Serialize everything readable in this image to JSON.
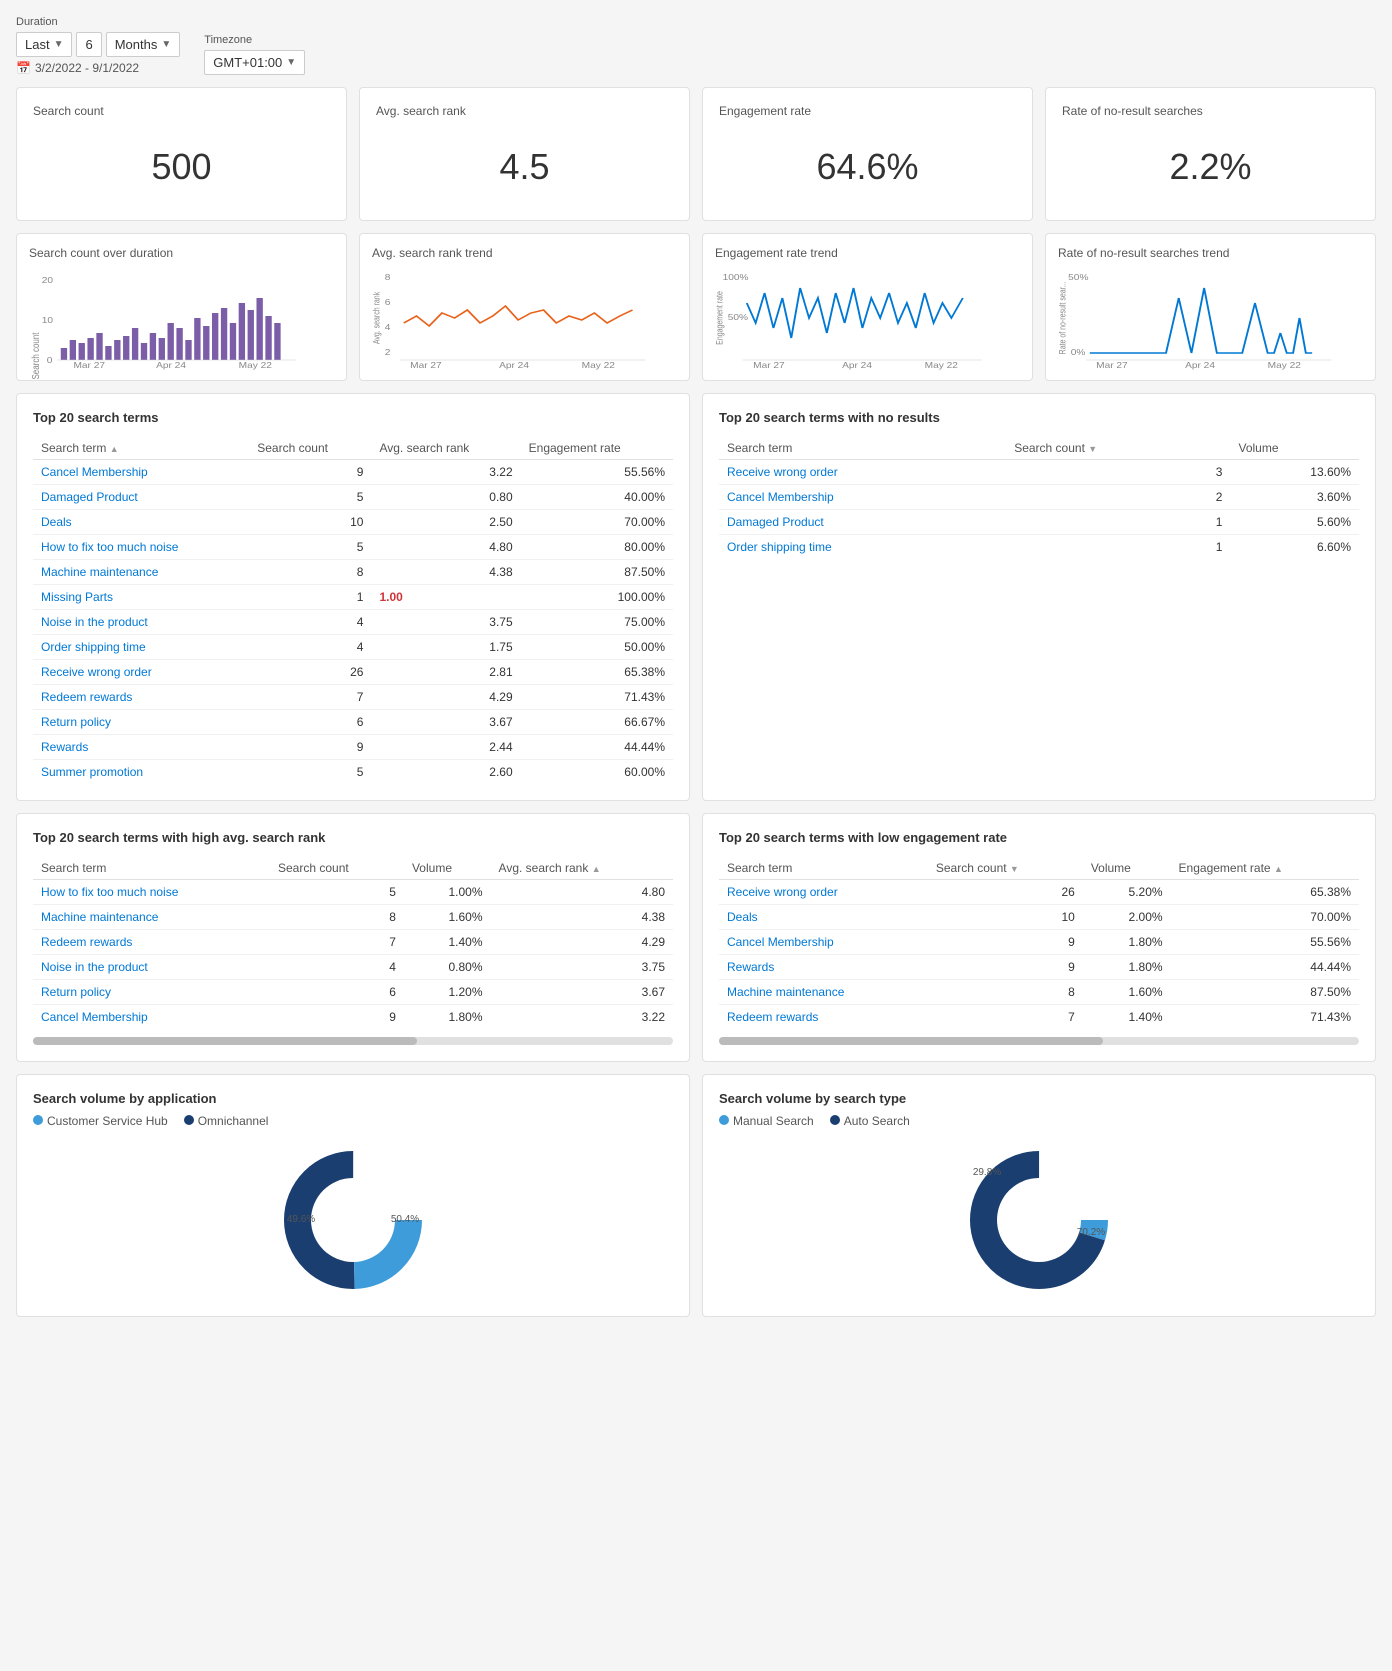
{
  "controls": {
    "duration_label": "Duration",
    "last_label": "Last",
    "last_value": "6",
    "months_value": "Months",
    "timezone_label": "Timezone",
    "timezone_value": "GMT+01:00",
    "date_range": "3/2/2022 - 9/1/2022"
  },
  "metric_cards": [
    {
      "title": "Search count",
      "value": "500"
    },
    {
      "title": "Avg. search rank",
      "value": "4.5"
    },
    {
      "title": "Engagement rate",
      "value": "64.6%"
    },
    {
      "title": "Rate of no-result searches",
      "value": "2.2%"
    }
  ],
  "chart_cards": [
    {
      "title": "Search count over duration",
      "type": "bar",
      "color": "#7B5EA7",
      "x_labels": [
        "Mar 27",
        "Apr 24",
        "May 22"
      ],
      "y_max": 20,
      "y_labels": [
        "0",
        "10",
        "20"
      ],
      "y_axis_label": "Search count"
    },
    {
      "title": "Avg. search rank trend",
      "type": "line",
      "color": "#E8621A",
      "x_labels": [
        "Mar 27",
        "Apr 24",
        "May 22"
      ],
      "y_max": 8,
      "y_labels": [
        "2",
        "4",
        "6",
        "8"
      ],
      "y_axis_label": "Avg. search rank"
    },
    {
      "title": "Engagement rate trend",
      "type": "line",
      "color": "#0078D4",
      "x_labels": [
        "Mar 27",
        "Apr 24",
        "May 22"
      ],
      "y_max": 100,
      "y_labels": [
        "50%",
        "100%"
      ],
      "y_axis_label": "Engagement rate"
    },
    {
      "title": "Rate of no-result searches trend",
      "type": "line",
      "color": "#0078D4",
      "x_labels": [
        "Mar 27",
        "Apr 24",
        "May 22"
      ],
      "y_max": 50,
      "y_labels": [
        "0%",
        "50%"
      ],
      "y_axis_label": "Rate of no-result sear..."
    }
  ],
  "top20_table": {
    "title": "Top 20 search terms",
    "columns": [
      "Search term",
      "Search count",
      "Avg. search rank",
      "Engagement rate"
    ],
    "rows": [
      [
        "Cancel Membership",
        "9",
        "3.22",
        "55.56%"
      ],
      [
        "Damaged Product",
        "5",
        "0.80",
        "40.00%"
      ],
      [
        "Deals",
        "10",
        "2.50",
        "70.00%"
      ],
      [
        "How to fix too much noise",
        "5",
        "4.80",
        "80.00%"
      ],
      [
        "Machine maintenance",
        "8",
        "4.38",
        "87.50%"
      ],
      [
        "Missing Parts",
        "1",
        "1.00",
        "100.00%"
      ],
      [
        "Noise in the product",
        "4",
        "3.75",
        "75.00%"
      ],
      [
        "Order shipping time",
        "4",
        "1.75",
        "50.00%"
      ],
      [
        "Receive wrong order",
        "26",
        "2.81",
        "65.38%"
      ],
      [
        "Redeem rewards",
        "7",
        "4.29",
        "71.43%"
      ],
      [
        "Return policy",
        "6",
        "3.67",
        "66.67%"
      ],
      [
        "Rewards",
        "9",
        "2.44",
        "44.44%"
      ],
      [
        "Summer promotion",
        "5",
        "2.60",
        "60.00%"
      ]
    ]
  },
  "no_results_table": {
    "title": "Top 20 search terms with no results",
    "columns": [
      "Search term",
      "Search count",
      "Volume"
    ],
    "rows": [
      [
        "Receive wrong order",
        "3",
        "13.60%"
      ],
      [
        "Cancel Membership",
        "2",
        "3.60%"
      ],
      [
        "Damaged Product",
        "1",
        "5.60%"
      ],
      [
        "Order shipping time",
        "1",
        "6.60%"
      ]
    ]
  },
  "high_rank_table": {
    "title": "Top 20 search terms with high avg. search rank",
    "columns": [
      "Search term",
      "Search count",
      "Volume",
      "Avg. search rank"
    ],
    "rows": [
      [
        "How to fix too much noise",
        "5",
        "1.00%",
        "4.80"
      ],
      [
        "Machine maintenance",
        "8",
        "1.60%",
        "4.38"
      ],
      [
        "Redeem rewards",
        "7",
        "1.40%",
        "4.29"
      ],
      [
        "Noise in the product",
        "4",
        "0.80%",
        "3.75"
      ],
      [
        "Return policy",
        "6",
        "1.20%",
        "3.67"
      ],
      [
        "Cancel Membership",
        "9",
        "1.80%",
        "3.22"
      ]
    ]
  },
  "low_engagement_table": {
    "title": "Top 20 search terms with low engagement rate",
    "columns": [
      "Search term",
      "Search count",
      "Volume",
      "Engagement rate"
    ],
    "rows": [
      [
        "Receive wrong order",
        "26",
        "5.20%",
        "65.38%"
      ],
      [
        "Deals",
        "10",
        "2.00%",
        "70.00%"
      ],
      [
        "Cancel Membership",
        "9",
        "1.80%",
        "55.56%"
      ],
      [
        "Rewards",
        "9",
        "1.80%",
        "44.44%"
      ],
      [
        "Machine maintenance",
        "8",
        "1.60%",
        "87.50%"
      ],
      [
        "Redeem rewards",
        "7",
        "1.40%",
        "71.43%"
      ]
    ]
  },
  "donut_app": {
    "title": "Search volume by application",
    "legends": [
      {
        "label": "Customer Service Hub",
        "color": "#3E9CDA"
      },
      {
        "label": "Omnichannel",
        "color": "#1A3E6F"
      }
    ],
    "segments": [
      {
        "label": "49.6%",
        "value": 49.6,
        "color": "#3E9CDA"
      },
      {
        "label": "50.4%",
        "value": 50.4,
        "color": "#1A3E6F"
      }
    ]
  },
  "donut_type": {
    "title": "Search volume by search type",
    "legends": [
      {
        "label": "Manual Search",
        "color": "#3E9CDA"
      },
      {
        "label": "Auto Search",
        "color": "#1A3E6F"
      }
    ],
    "segments": [
      {
        "label": "29.8%",
        "value": 29.8,
        "color": "#3E9CDA"
      },
      {
        "label": "70.2%",
        "value": 70.2,
        "color": "#1A3E6F"
      }
    ]
  }
}
